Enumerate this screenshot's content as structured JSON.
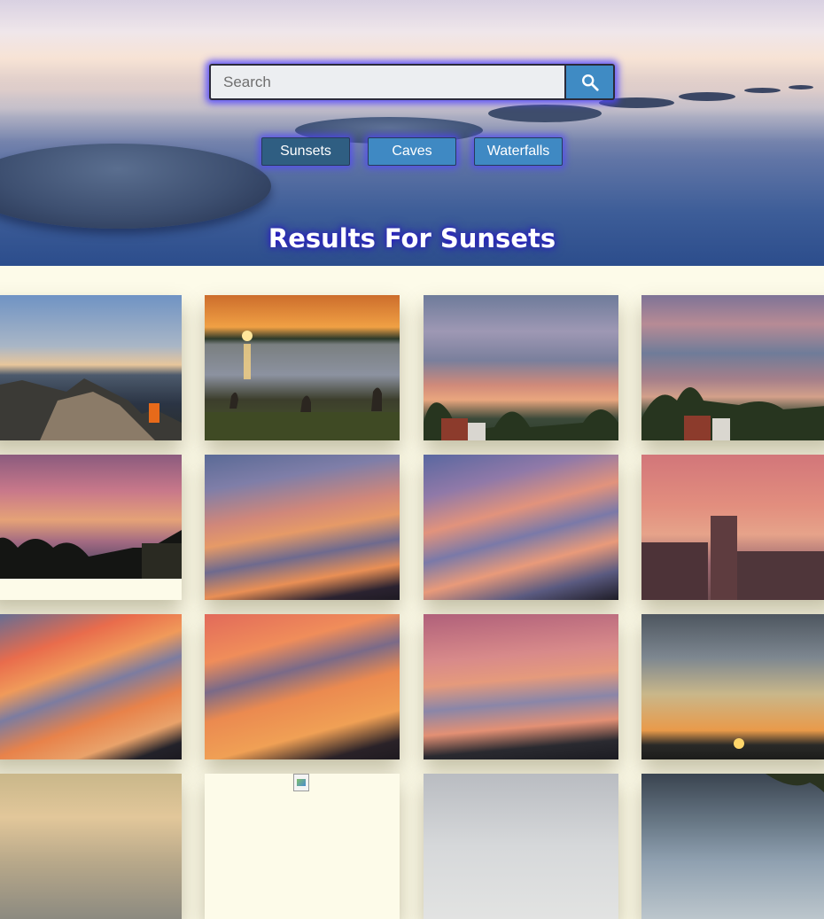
{
  "search": {
    "placeholder": "Search"
  },
  "categories": [
    {
      "label": "Sunsets",
      "selected": true
    },
    {
      "label": "Caves",
      "selected": false
    },
    {
      "label": "Waterfalls",
      "selected": false
    }
  ],
  "results_title": "Results For Sunsets",
  "colors": {
    "accent": "#3f89c3",
    "accent_selected": "#2f5e82",
    "glow": "#5046ff",
    "page_background": "#fdfbe9"
  },
  "images": [
    {
      "name": "mountain-hiker-sunset",
      "loaded": true
    },
    {
      "name": "geese-lake-sunset",
      "loaded": true
    },
    {
      "name": "cloudy-neighborhood-sunset",
      "loaded": true
    },
    {
      "name": "cloudy-neighborhood-sunset-2",
      "loaded": true
    },
    {
      "name": "pink-clouds-house-sunset",
      "loaded": true
    },
    {
      "name": "streaked-skyline-sunset",
      "loaded": true
    },
    {
      "name": "violet-streaks-skyline-sunset",
      "loaded": true
    },
    {
      "name": "pink-sky-buildings-sunset",
      "loaded": true
    },
    {
      "name": "orange-streaks-sunset",
      "loaded": true
    },
    {
      "name": "fiery-skyline-sunset",
      "loaded": true
    },
    {
      "name": "pink-clouds-city-sunset",
      "loaded": true
    },
    {
      "name": "dusk-sun-horizon",
      "loaded": true
    },
    {
      "name": "golden-clouds",
      "loaded": true
    },
    {
      "name": "broken-image",
      "loaded": false
    },
    {
      "name": "grey-sky",
      "loaded": true
    },
    {
      "name": "tree-cloudy-sky",
      "loaded": true
    }
  ]
}
